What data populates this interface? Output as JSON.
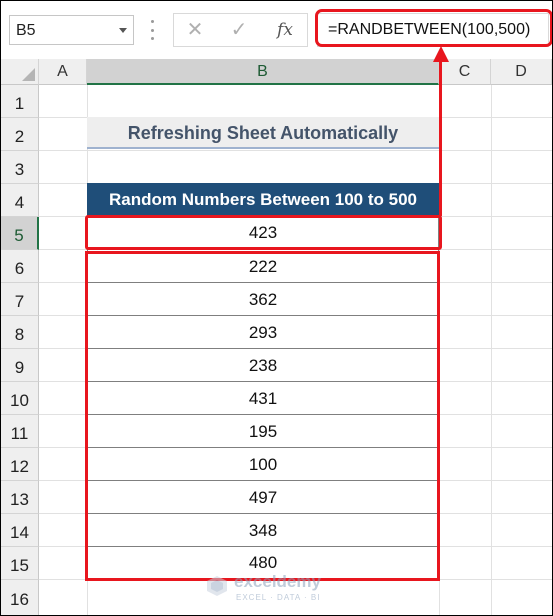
{
  "name_box": {
    "value": "B5"
  },
  "formula_bar": {
    "formula": "=RANDBETWEEN(100,500)",
    "fx_label": "fx",
    "cancel_icon": "✕",
    "enter_icon": "✓"
  },
  "columns": [
    "A",
    "B",
    "C",
    "D"
  ],
  "selected_column": "B",
  "rows": [
    "1",
    "2",
    "3",
    "4",
    "5",
    "6",
    "7",
    "8",
    "9",
    "10",
    "11",
    "12",
    "13",
    "14",
    "15",
    "16"
  ],
  "selected_row": "5",
  "sheet": {
    "title": "Refreshing Sheet Automatically",
    "table_header": "Random Numbers Between 100 to 500",
    "values": [
      "423",
      "222",
      "362",
      "293",
      "238",
      "431",
      "195",
      "100",
      "497",
      "348",
      "480"
    ]
  },
  "watermark": {
    "name": "exceldemy",
    "tagline": "EXCEL · DATA · BI"
  },
  "colors": {
    "accent_red": "#e8161e",
    "header_fill": "#1f4e79",
    "title_text": "#44546a",
    "excel_green": "#217346"
  }
}
